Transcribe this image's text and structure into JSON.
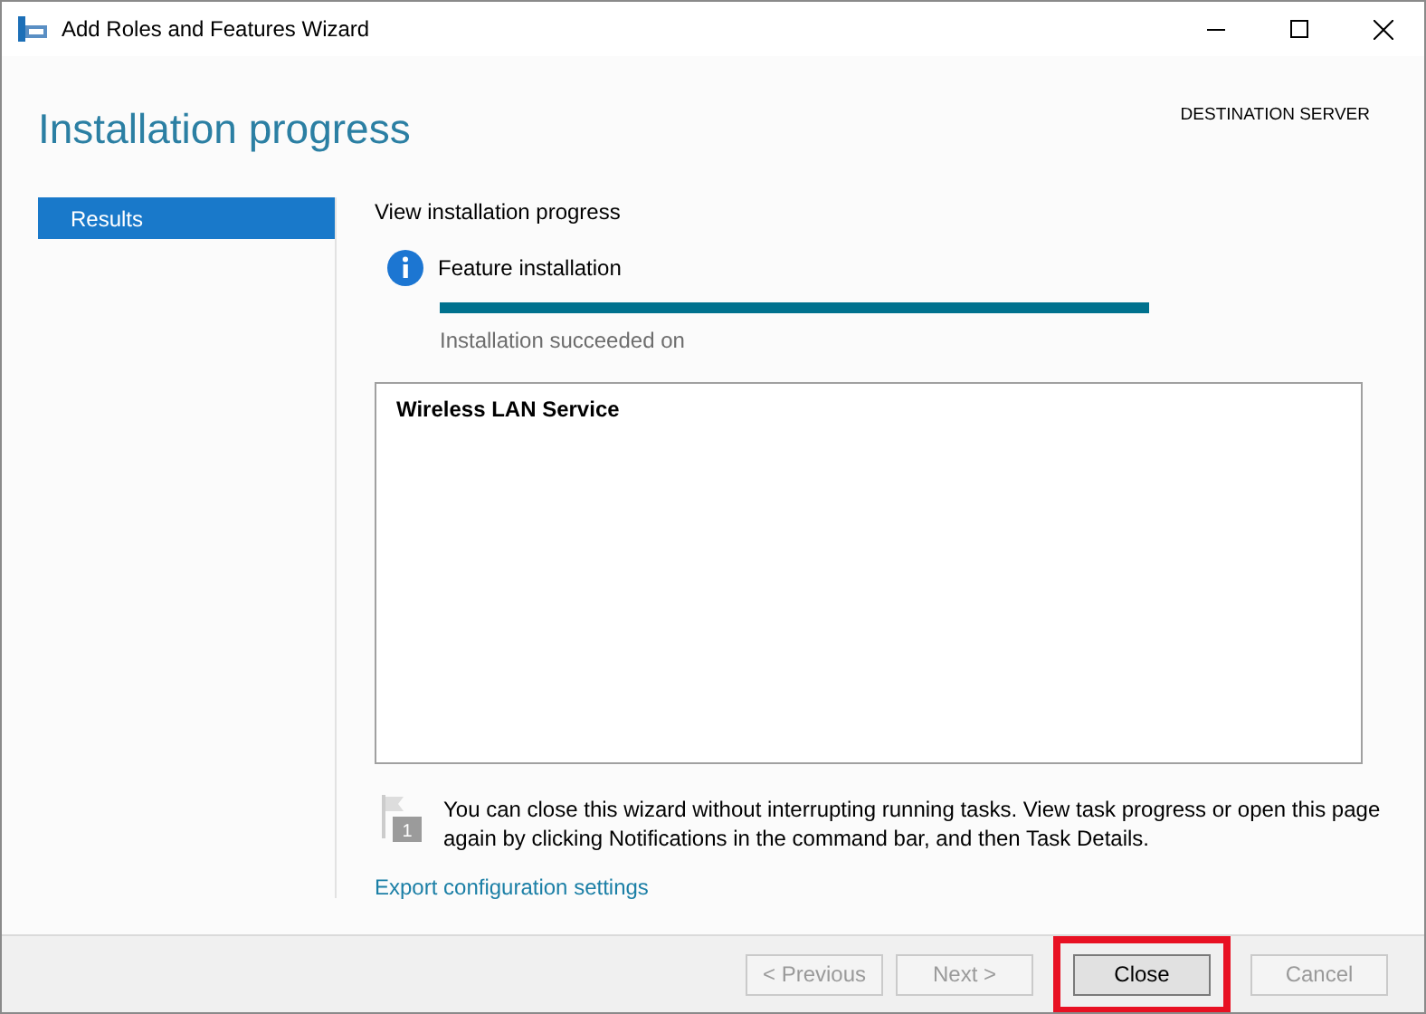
{
  "window": {
    "title": "Add Roles and Features Wizard"
  },
  "header": {
    "title": "Installation progress",
    "destination_label": "DESTINATION SERVER"
  },
  "sidebar": {
    "items": [
      {
        "label": "Results",
        "selected": true
      }
    ]
  },
  "content": {
    "heading": "View installation progress",
    "status_title": "Feature installation",
    "progress": {
      "level": 1.0
    },
    "status_text": "Installation succeeded on",
    "results": [
      "Wireless LAN Service"
    ],
    "notice": {
      "badge": "1",
      "text": "You can close this wizard without interrupting running tasks. View task progress or open this page again by clicking Notifications in the command bar, and then Task Details."
    },
    "export_link": "Export configuration settings"
  },
  "buttons": [
    {
      "label": "< Previous",
      "disabled": true,
      "highlighted": false
    },
    {
      "label": "Next >",
      "disabled": true,
      "highlighted": false
    },
    {
      "label": "Close",
      "disabled": false,
      "highlighted": true
    },
    {
      "label": "Cancel",
      "disabled": true,
      "highlighted": false
    }
  ]
}
